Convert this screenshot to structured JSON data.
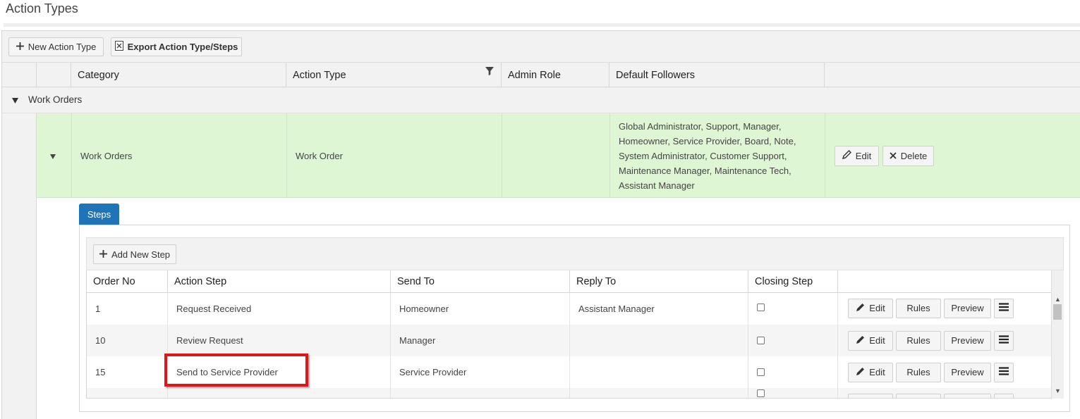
{
  "page": {
    "title": "Action Types"
  },
  "toolbar": {
    "new_action_type_label": "New Action Type",
    "export_label": "Export Action Type/Steps"
  },
  "grid": {
    "columns": [
      "Category",
      "Action Type",
      "Admin Role",
      "Default Followers"
    ],
    "group_label": "Work Orders",
    "row": {
      "category": "Work Orders",
      "action_type": "Work Order",
      "admin_role": "",
      "followers_lines": [
        "Global Administrator, Support, Manager,",
        "Homeowner, Service Provider, Board, Note,",
        "System Administrator, Customer Support,",
        "Maintenance Manager, Maintenance Tech,",
        "Assistant Manager"
      ],
      "edit_label": "Edit",
      "delete_label": "Delete"
    }
  },
  "detail": {
    "tab_label": "Steps",
    "add_step_label": "Add New Step",
    "columns": [
      "Order No",
      "Action Step",
      "Send To",
      "Reply To",
      "Closing Step"
    ],
    "rows": [
      {
        "order": "1",
        "step": "Request Received",
        "send_to": "Homeowner",
        "reply_to": "Assistant Manager",
        "closing": false
      },
      {
        "order": "10",
        "step": "Review Request",
        "send_to": "Manager",
        "reply_to": "",
        "closing": false
      },
      {
        "order": "15",
        "step": "Send to Service Provider",
        "send_to": "Service Provider",
        "reply_to": "",
        "closing": false
      },
      {
        "order": "",
        "step": "",
        "send_to": "",
        "reply_to": "",
        "closing": false
      }
    ],
    "row_buttons": {
      "edit": "Edit",
      "rules": "Rules",
      "preview": "Preview"
    }
  },
  "icons": {
    "plus": "plus-icon",
    "excel": "excel-icon",
    "filter": "filter-icon",
    "pencil": "pencil-icon",
    "close": "close-icon",
    "menu": "hamburger-icon",
    "collapse": "triangle-down-icon"
  },
  "colors": {
    "selected_row": "#dff6d5",
    "tab": "#1f73b7",
    "highlight": "#e0161e"
  }
}
